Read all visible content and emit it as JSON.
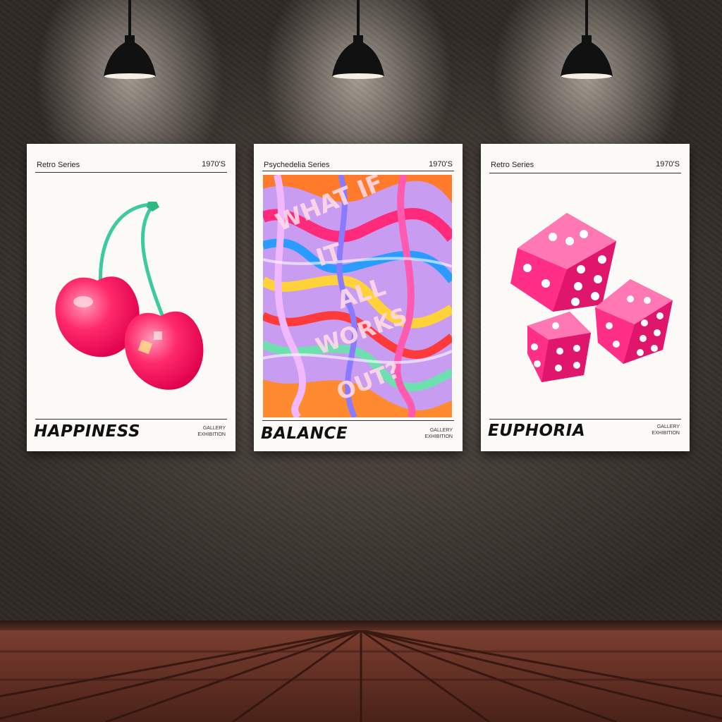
{
  "posters": [
    {
      "series": "Retro Series",
      "year": "1970'S",
      "title": "HAPPINESS",
      "gallery_line1": "GALLERY",
      "gallery_line2": "EXHIBITION",
      "artwork": "cherries-illustration"
    },
    {
      "series": "Psychedelia Series",
      "year": "1970'S",
      "title": "BALANCE",
      "gallery_line1": "GALLERY",
      "gallery_line2": "EXHIBITION",
      "artwork": "psychedelic-swirl-illustration",
      "art_text": [
        "WHAT IF",
        "IT",
        "ALL",
        "WORKS",
        "OUT?"
      ]
    },
    {
      "series": "Retro Series",
      "year": "1970'S",
      "title": "EUPHORIA",
      "gallery_line1": "GALLERY",
      "gallery_line2": "EXHIBITION",
      "artwork": "pink-dice-illustration"
    }
  ],
  "lamps": [
    "ceiling-lamp-icon",
    "ceiling-lamp-icon",
    "ceiling-lamp-icon"
  ],
  "colors": {
    "wall": "#4a423c",
    "floor": "#6a342a",
    "poster_bg": "#fbfaf6",
    "cherry": "#ff2a6a",
    "dice": "#ff2e86",
    "stem": "#3fc9a0"
  }
}
